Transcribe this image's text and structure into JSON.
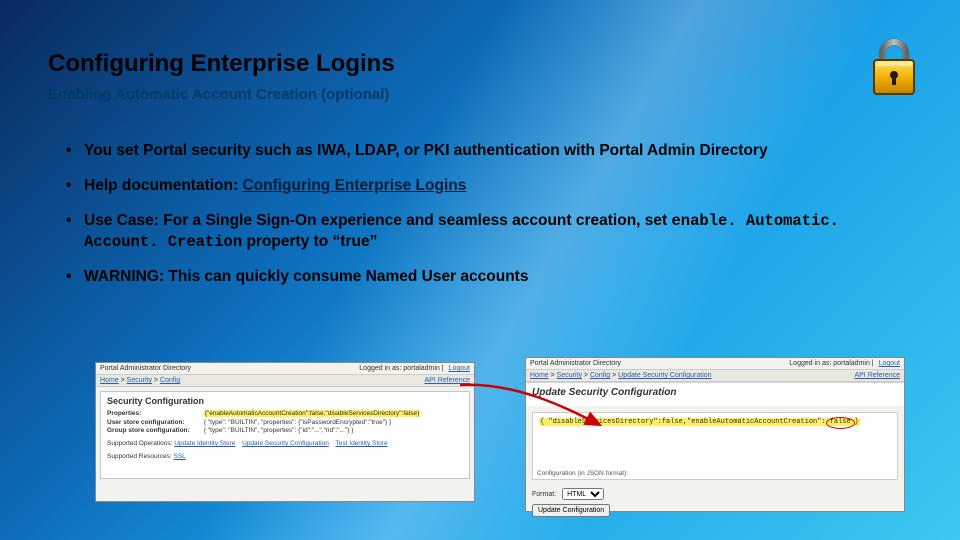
{
  "title": "Configuring Enterprise Logins",
  "subtitle": "Enabling Automatic Account Creation (optional)",
  "bullets": {
    "b1": "You set Portal security such as IWA, LDAP, or PKI authentication with Portal Admin Directory",
    "b2_prefix": "Help documentation:  ",
    "b2_link": "Configuring Enterprise Logins",
    "b3_pre": "Use Case: For a Single Sign-On experience and seamless account creation, set ",
    "b3_code": "enable. Automatic. Account. Creation",
    "b3_post": " property to “true”",
    "b4": "WARNING: This can quickly consume Named User accounts"
  },
  "leftShot": {
    "windowTitle": "Portal Administrator Directory",
    "loggedInLabel": "Logged in as:",
    "loggedInUser": "portaladmin",
    "logout": "Logout",
    "crumb1": "Home",
    "crumb2": "Security",
    "crumb3": "Config",
    "apiRef": "API Reference",
    "panelTitle": "Security Configuration",
    "propLabel": "Properties:",
    "propValue": "{\"enableAutomaticAccountCreation\":false,\"disableServicesDirectory\":false}",
    "userLabel": "User store configuration:",
    "userValue": "{ \"type\": \"BUILTIN\", \"properties\": {\"isPasswordEncrypted\":\"true\"} }",
    "groupLabel": "Group store configuration:",
    "groupValue": "{ \"type\": \"BUILTIN\", \"properties\": {\"id\":\"...\",\"rid\":\"...\"} }",
    "supportedLabel": "Supported Operations:",
    "supportedLinks": [
      "Update Identity Store",
      "Update Security Configuration",
      "Test Identity Store"
    ],
    "resourcesLabel": "Supported Resources:",
    "resourcesLinks": [
      "SSL"
    ]
  },
  "rightShot": {
    "windowTitle": "Portal Administrator Directory",
    "loggedInLabel": "Logged in as:",
    "loggedInUser": "portaladmin",
    "logout": "Logout",
    "crumb1": "Home",
    "crumb2": "Security",
    "crumb3": "Config",
    "crumb4": "Update Security Configuration",
    "apiRef": "API Reference",
    "panelTitle": "Update Security Configuration",
    "jsonPre": "{ \"disableServicesDirectory\":false,\"enableAutomaticAccountCreation\":",
    "jsonHighlight": "false",
    "jsonPost": "}",
    "configLabel": "Configuration (in JSON format):",
    "formatLabel": "Format:",
    "formatValue": "HTML",
    "buttonLabel": "Update Configuration"
  }
}
